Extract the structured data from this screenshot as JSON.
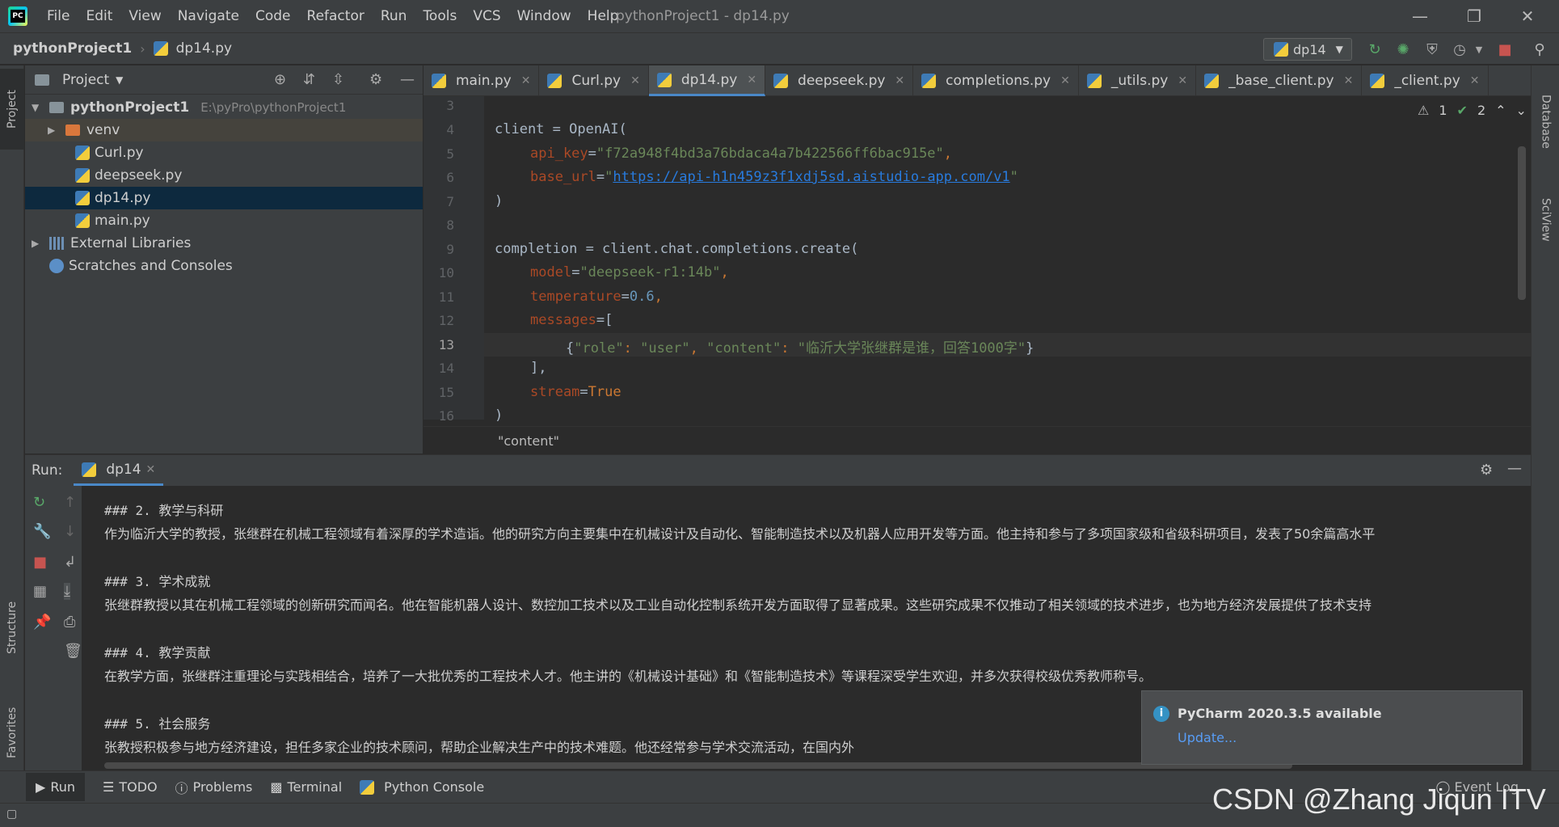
{
  "titlebar": {
    "menus": [
      "File",
      "Edit",
      "View",
      "Navigate",
      "Code",
      "Refactor",
      "Run",
      "Tools",
      "VCS",
      "Window",
      "Help"
    ],
    "window_title": "pythonProject1 - dp14.py"
  },
  "navbar": {
    "project": "pythonProject1",
    "file": "dp14.py",
    "run_config": "dp14"
  },
  "left_strip": {
    "project_tab": "Project",
    "structure_tab": "Structure",
    "favorites_tab": "Favorites"
  },
  "right_strip": {
    "database_tab": "Database",
    "sciview_tab": "SciView"
  },
  "project_panel": {
    "title": "Project",
    "root": {
      "name": "pythonProject1",
      "path": "E:\\pyPro\\pythonProject1"
    },
    "items": [
      "venv",
      "Curl.py",
      "deepseek.py",
      "dp14.py",
      "main.py"
    ],
    "external": "External Libraries",
    "scratches": "Scratches and Consoles"
  },
  "editor": {
    "tabs": [
      "main.py",
      "Curl.py",
      "dp14.py",
      "deepseek.py",
      "completions.py",
      "_utils.py",
      "_base_client.py",
      "_client.py"
    ],
    "active_tab": "dp14.py",
    "inspection_warnings": "1",
    "inspection_ok": "2",
    "line_numbers": [
      "3",
      "4",
      "5",
      "6",
      "7",
      "8",
      "9",
      "10",
      "11",
      "12",
      "13",
      "14",
      "15",
      "16"
    ],
    "code": {
      "l4a": "client = OpenAI(",
      "l5_key": "api_key",
      "l5_val": "\"f72a948f4bd3a76bdaca4a7b422566ff6bac915e\"",
      "l6_key": "base_url",
      "l6_val": "https://api-h1n459z3f1xdj5sd.aistudio-app.com/v1",
      "l7": ")",
      "l9": "completion = client.chat.completions.create(",
      "l10_key": "model",
      "l10_val": "\"deepseek-r1:14b\"",
      "l11_key": "temperature",
      "l11_val": "0.6",
      "l12_key": "messages",
      "l13_a": "\"role\"",
      "l13_b": "\"user\"",
      "l13_c": "\"content\"",
      "l13_d": "\"临沂大学张继群是谁，回答1000字\"",
      "l14": "],",
      "l15_key": "stream",
      "l15_val": "True",
      "l16": ")"
    },
    "breadcrumb": "\"content\""
  },
  "run_panel": {
    "label": "Run:",
    "tab": "dp14",
    "output": [
      "### 2. 教学与科研",
      "作为临沂大学的教授，张继群在机械工程领域有着深厚的学术造诣。他的研究方向主要集中在机械设计及自动化、智能制造技术以及机器人应用开发等方面。他主持和参与了多项国家级和省级科研项目，发表了50余篇高水平",
      "### 3. 学术成就",
      "张继群教授以其在机械工程领域的创新研究而闻名。他在智能机器人设计、数控加工技术以及工业自动化控制系统开发方面取得了显著成果。这些研究成果不仅推动了相关领域的技术进步，也为地方经济发展提供了技术支持",
      "### 4. 教学贡献",
      "在教学方面，张继群注重理论与实践相结合，培养了一大批优秀的工程技术人才。他主讲的《机械设计基础》和《智能制造技术》等课程深受学生欢迎，并多次获得校级优秀教师称号。",
      "### 5. 社会服务",
      "张教授积极参与地方经济建设，担任多家企业的技术顾问，帮助企业解决生产中的技术难题。他还经常参与学术交流活动，在国内外"
    ]
  },
  "notification": {
    "title": "PyCharm 2020.3.5 available",
    "link": "Update..."
  },
  "bottom_bar": {
    "run": "Run",
    "todo": "TODO",
    "problems": "Problems",
    "terminal": "Terminal",
    "python_console": "Python Console",
    "event_log": "Event Log"
  },
  "watermark": "CSDN @Zhang Jiqun ITV"
}
